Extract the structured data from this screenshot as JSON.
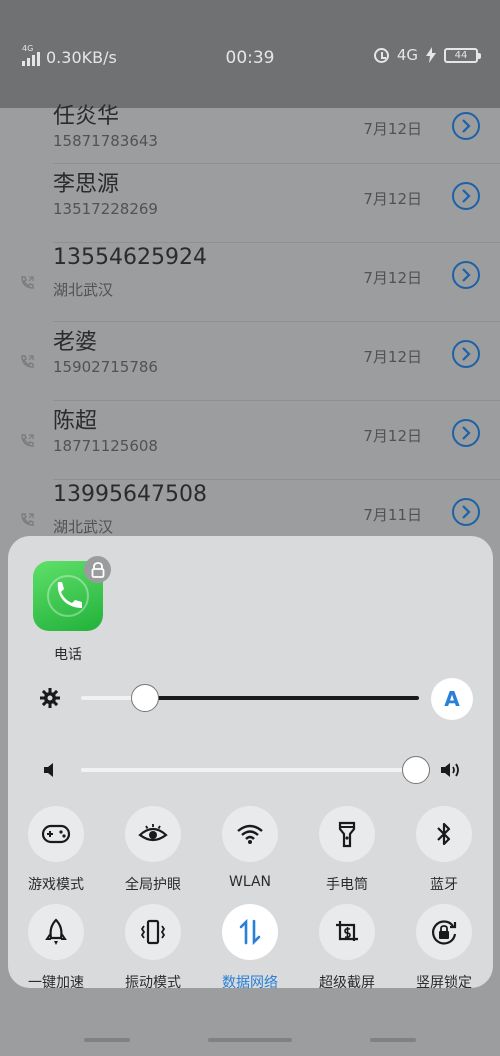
{
  "status_bar": {
    "network_tag": "4G",
    "speed": "0.30KB/s",
    "time": "00:39",
    "network_right": "4G",
    "battery": "44"
  },
  "call_list": [
    {
      "name": "任炎华",
      "sub": "15871783643",
      "date": "7月12日",
      "has_call_icon": false
    },
    {
      "name": "李思源",
      "sub": "13517228269",
      "date": "7月12日",
      "has_call_icon": false
    },
    {
      "name": "13554625924",
      "sub": "湖北武汉",
      "date": "7月12日",
      "has_call_icon": true
    },
    {
      "name": "老婆",
      "sub": "15902715786",
      "date": "7月12日",
      "has_call_icon": true
    },
    {
      "name": "陈超",
      "sub": "18771125608",
      "date": "7月12日",
      "has_call_icon": true
    },
    {
      "name": "13995647508",
      "sub": "湖北武汉",
      "date": "7月11日",
      "has_call_icon": true
    }
  ],
  "panel": {
    "app_label": "电话",
    "brightness": {
      "level": 0.19,
      "auto_label": "A"
    },
    "volume": {
      "level": 0.99
    },
    "toggles_row1": [
      {
        "label": "游戏模式",
        "icon": "gamepad-icon",
        "active": false
      },
      {
        "label": "全局护眼",
        "icon": "eye-icon",
        "active": false
      },
      {
        "label": "WLAN",
        "icon": "wifi-icon",
        "active": false
      },
      {
        "label": "手电筒",
        "icon": "flashlight-icon",
        "active": false
      },
      {
        "label": "蓝牙",
        "icon": "bluetooth-icon",
        "active": false
      }
    ],
    "toggles_row2": [
      {
        "label": "一键加速",
        "icon": "rocket-icon",
        "active": false
      },
      {
        "label": "振动模式",
        "icon": "vibrate-icon",
        "active": false
      },
      {
        "label": "数据网络",
        "icon": "data-arrows-icon",
        "active": true
      },
      {
        "label": "超级截屏",
        "icon": "screenshot-icon",
        "active": false
      },
      {
        "label": "竖屏锁定",
        "icon": "rotation-lock-icon",
        "active": false
      }
    ]
  },
  "colors": {
    "accent": "#2a7fd6",
    "info_button": "#1d62a6",
    "phone_green": "#22b13a"
  }
}
